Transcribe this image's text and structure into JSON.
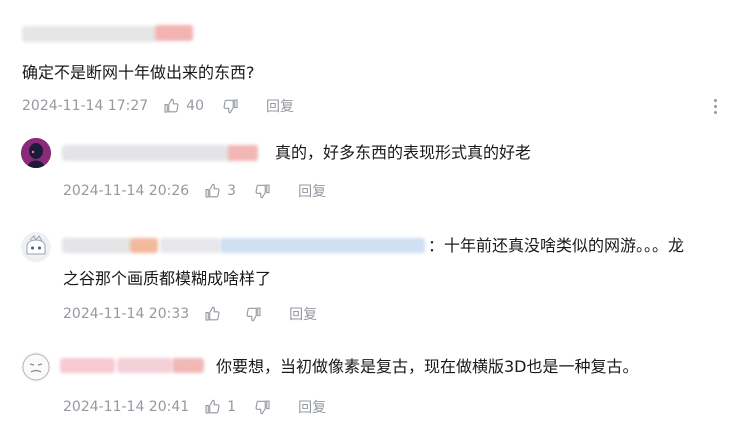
{
  "main_comment": {
    "text": "确定不是断网十年做出来的东西?",
    "time": "2024-11-14 17:27",
    "likes": "40",
    "reply_label": "回复"
  },
  "replies": [
    {
      "text": "真的，好多东西的表现形式真的好老",
      "time": "2024-11-14 20:26",
      "likes": "3",
      "reply_label": "回复"
    },
    {
      "text_line1": "：十年前还真没啥类似的网游。。。龙",
      "text_line2": "之谷那个画质都模糊成啥样了",
      "time": "2024-11-14 20:33",
      "likes": "",
      "reply_label": "回复"
    },
    {
      "text": "你要想，当初做像素是复古，现在做横版3D也是一种复古。",
      "time": "2024-11-14 20:41",
      "likes": "1",
      "reply_label": "回复"
    }
  ],
  "icons": {
    "like": "thumbs-up-icon",
    "dislike": "thumbs-down-icon",
    "more": "more-vertical-icon"
  }
}
